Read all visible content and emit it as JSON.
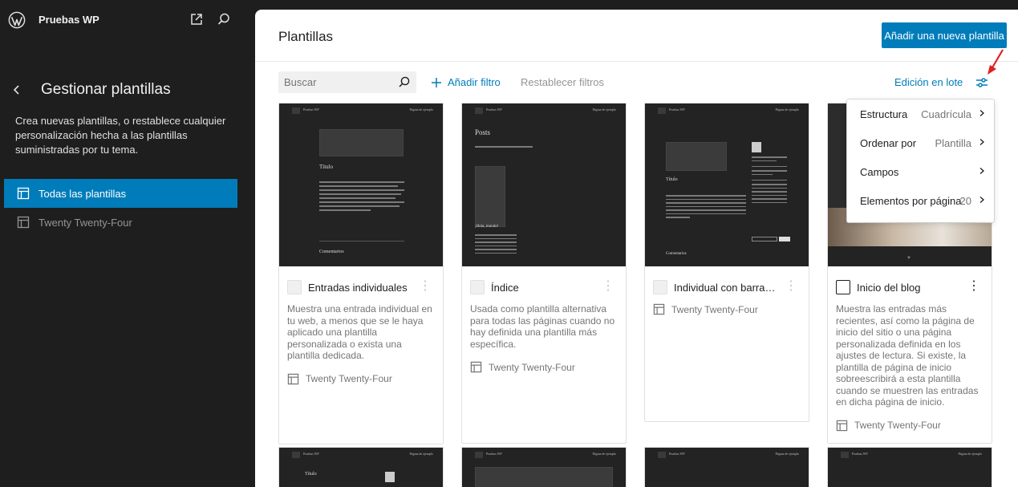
{
  "topbar": {
    "site_name": "Pruebas WP"
  },
  "sidebar": {
    "title": "Gestionar plantillas",
    "description": "Crea nuevas plantillas, o restablece cualquier personalización hecha a las plantillas suministradas por tu tema.",
    "items": [
      {
        "label": "Todas las plantillas",
        "active": true
      },
      {
        "label": "Twenty Twenty-Four",
        "active": false
      }
    ]
  },
  "main": {
    "title": "Plantillas",
    "add_button": "Añadir una nueva plantilla",
    "search_placeholder": "Buscar",
    "add_filter": "Añadir filtro",
    "reset_filters": "Restablecer filtros",
    "bulk_edit": "Edición en lote"
  },
  "cards": [
    {
      "name": "Entradas individuales",
      "description": "Muestra una entrada individual en tu web, a menos que se le haya aplicado una plantilla personalizada o exista una plantilla dedicada.",
      "author": "Twenty Twenty-Four",
      "preview_site": "Pruebas WP",
      "preview_nav": "Página de ejemplo",
      "preview_title": "Título",
      "preview_comments": "Comentarios"
    },
    {
      "name": "Índice",
      "description": "Usada como plantilla alternativa para todas las páginas cuando no hay definida una plantilla más específica.",
      "author": "Twenty Twenty-Four",
      "preview_site": "Pruebas WP",
      "preview_nav": "Página de ejemplo",
      "preview_title": "Posts",
      "preview_post": "¡Hola, mundo!"
    },
    {
      "name": "Individual con barra lateral",
      "description": "",
      "author": "Twenty Twenty-Four",
      "preview_site": "Pruebas WP",
      "preview_nav": "Página de ejemplo",
      "preview_title": "Título",
      "preview_comments": "Comentarios"
    },
    {
      "name": "Inicio del blog",
      "description": "Muestra las entradas más recientes, así como la página de inicio del sitio o una página personalizada definida en los ajustes de lectura. Si existe, la plantilla de página de inicio sobreescribirá a esta plantilla cuando se muestren las entradas en dicha página de inicio.",
      "author": "Twenty Twenty-Four"
    }
  ],
  "view_menu": {
    "items": [
      {
        "label": "Estructura",
        "value": "Cuadrícula"
      },
      {
        "label": "Ordenar por",
        "value": "Plantilla"
      },
      {
        "label": "Campos",
        "value": ""
      },
      {
        "label": "Elementos por página",
        "value": "20"
      }
    ]
  },
  "colors": {
    "accent": "#007cba",
    "sidebar_bg": "#1e1e1e",
    "annotation_arrow": "#e02020"
  }
}
